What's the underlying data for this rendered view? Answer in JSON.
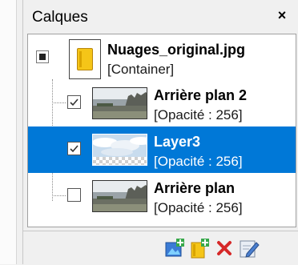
{
  "panel": {
    "title": "Calques",
    "close_label": "×"
  },
  "tree": {
    "root": {
      "name": "Nuages_original.jpg",
      "sub": "[Container]"
    },
    "layers": [
      {
        "name": "Arrière plan 2",
        "sub": "[Opacité : 256]",
        "checked": true,
        "selected": false
      },
      {
        "name": "Layer3",
        "sub": "[Opacité : 256]",
        "checked": true,
        "selected": true
      },
      {
        "name": "Arrière plan",
        "sub": "[Opacité : 256]",
        "checked": false,
        "selected": false
      }
    ]
  },
  "toolbar": {
    "icons": [
      "add-layer-icon",
      "add-container-icon",
      "delete-icon",
      "edit-icon"
    ]
  },
  "colors": {
    "selection": "#0078d7",
    "delete": "#d62828",
    "folder": "#f5c518"
  }
}
